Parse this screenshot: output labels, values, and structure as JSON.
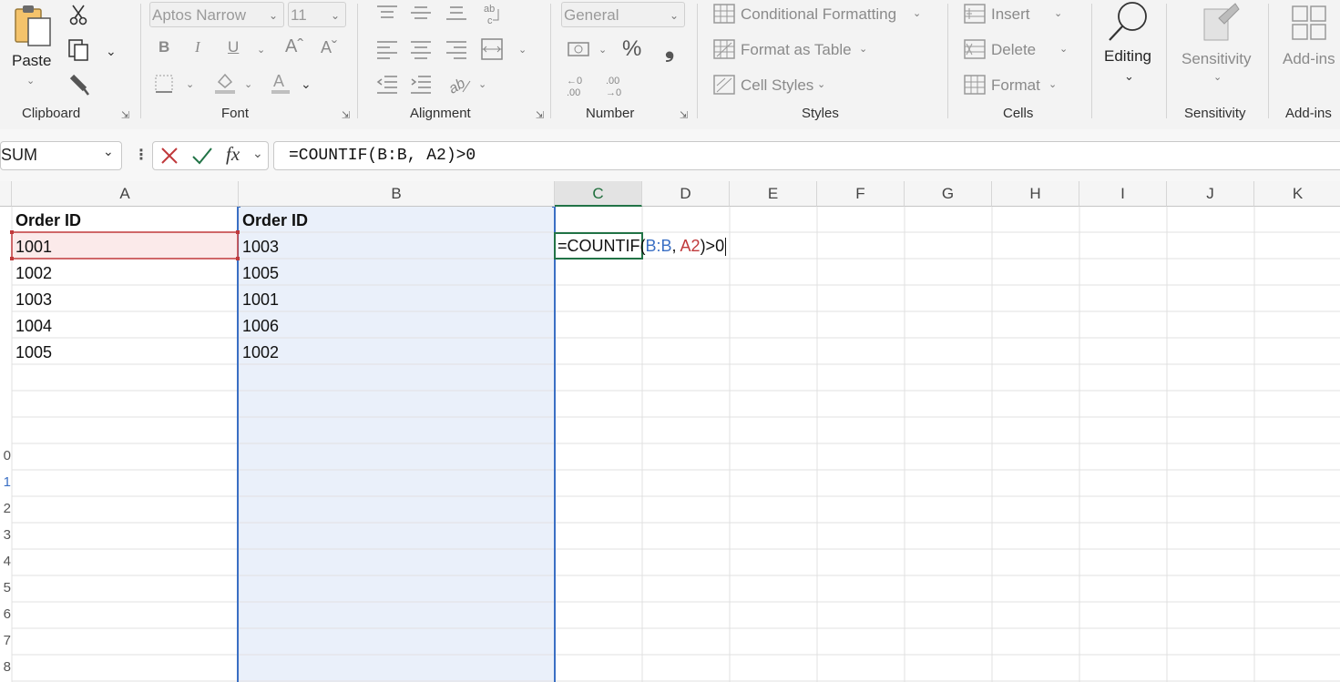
{
  "ribbon": {
    "clipboard": {
      "paste_label": "Paste",
      "group_label": "Clipboard"
    },
    "font": {
      "font_name": "Aptos Narrow",
      "font_size": "11",
      "group_label": "Font",
      "bold": "B",
      "italic": "I",
      "underline": "U"
    },
    "alignment": {
      "group_label": "Alignment"
    },
    "number": {
      "format": "General",
      "percent": "%",
      "comma": "❟",
      "group_label": "Number"
    },
    "styles": {
      "conditional_formatting": "Conditional Formatting",
      "format_as_table": "Format as Table",
      "cell_styles": "Cell Styles",
      "group_label": "Styles"
    },
    "cells": {
      "insert": "Insert",
      "delete": "Delete",
      "format": "Format",
      "group_label": "Cells"
    },
    "editing": {
      "label": "Editing"
    },
    "sensitivity": {
      "label": "Sensitivity",
      "group_label": "Sensitivity"
    },
    "addins": {
      "label": "Add-ins",
      "group_label": "Add-ins"
    }
  },
  "formula_bar": {
    "name_box": "SUM",
    "fx": "fx",
    "formula": "=COUNTIF(B:B, A2)>0"
  },
  "columns": [
    "A",
    "B",
    "C",
    "D",
    "E",
    "F",
    "G",
    "H",
    "I",
    "J",
    "K"
  ],
  "row_header_fragments": [
    "0",
    "1",
    "2",
    "3",
    "4",
    "5",
    "6",
    "7",
    "8"
  ],
  "cells": {
    "a1": "Order ID",
    "b1": "Order ID",
    "a2": "1001",
    "a3": "1002",
    "a4": "1003",
    "a5": "1004",
    "a6": "1005",
    "b2": "1003",
    "b3": "1005",
    "b4": "1001",
    "b5": "1006",
    "b6": "1002"
  },
  "edit_cell": {
    "part_func": "=COUNTIF(",
    "part_ref1": "B:B",
    "part_sep": ", ",
    "part_ref2": "A2",
    "part_tail": ")>0"
  },
  "colors": {
    "ref_blue": "#3a6fc4",
    "ref_red": "#c0393b",
    "accent_green": "#217346"
  }
}
